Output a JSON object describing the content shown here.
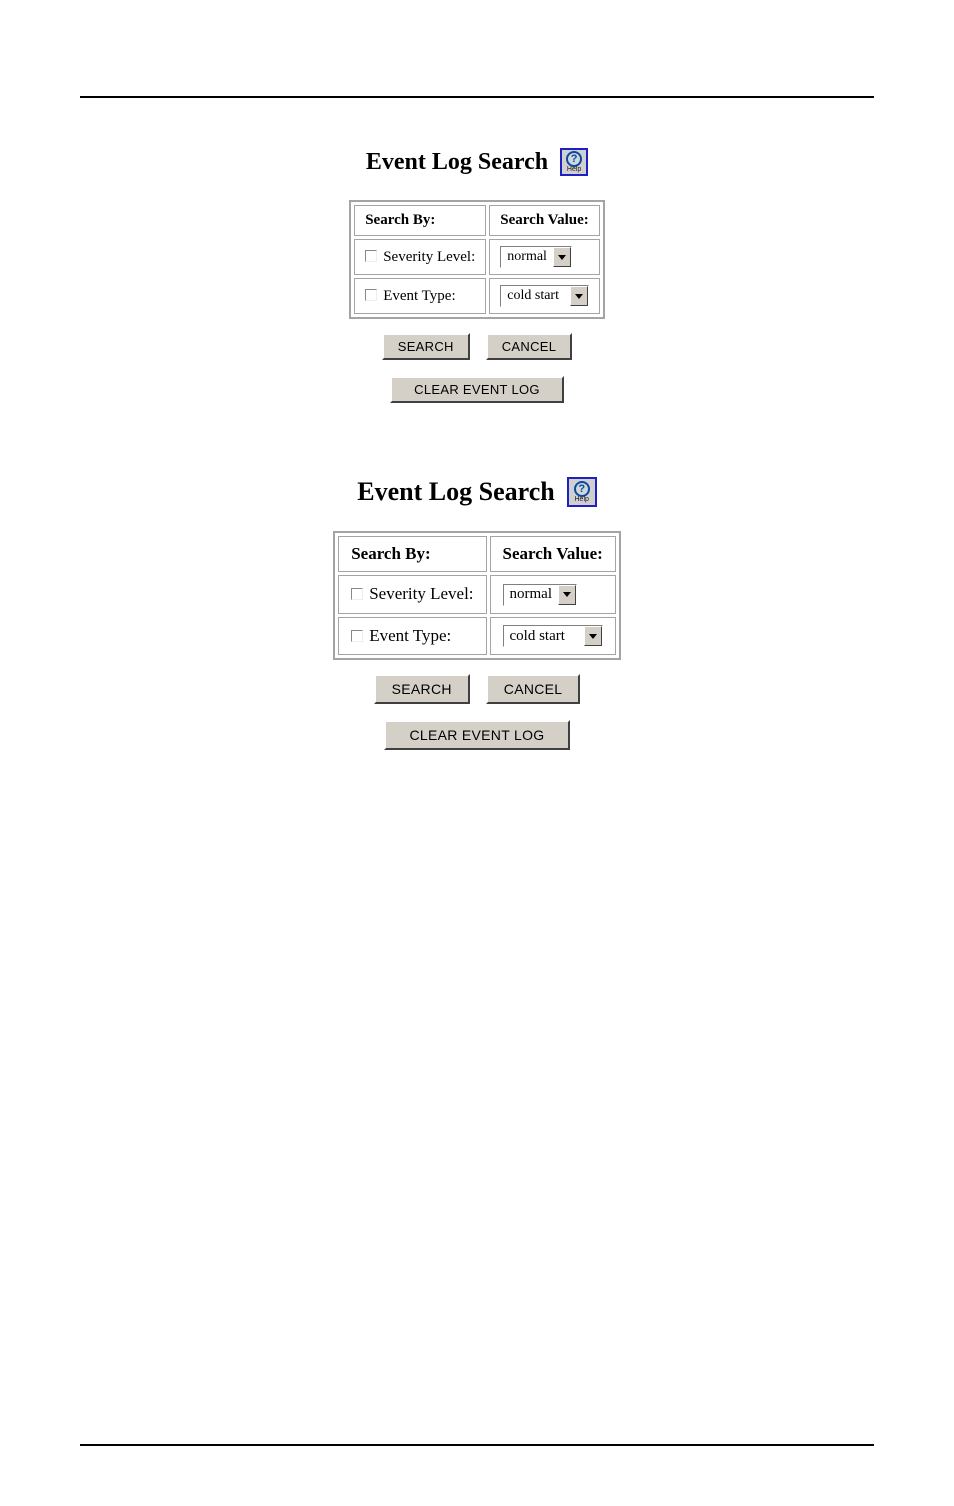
{
  "panel1": {
    "title": "Event Log Search",
    "help_label": "Help",
    "table": {
      "header_search_by": "Search By:",
      "header_search_value": "Search Value:",
      "row_severity_label": "Severity Level:",
      "row_event_type_label": "Event Type:",
      "severity_value": "normal",
      "event_type_value": "cold start"
    },
    "buttons": {
      "search": "SEARCH",
      "cancel": "CANCEL",
      "clear": "CLEAR EVENT LOG"
    }
  },
  "panel2": {
    "title": "Event Log Search",
    "help_label": "Help",
    "table": {
      "header_search_by": "Search By:",
      "header_search_value": "Search Value:",
      "row_severity_label": "Severity Level:",
      "row_event_type_label": "Event Type:",
      "severity_value": "normal",
      "event_type_value": "cold start"
    },
    "buttons": {
      "search": "SEARCH",
      "cancel": "CANCEL",
      "clear": "CLEAR EVENT LOG"
    }
  }
}
